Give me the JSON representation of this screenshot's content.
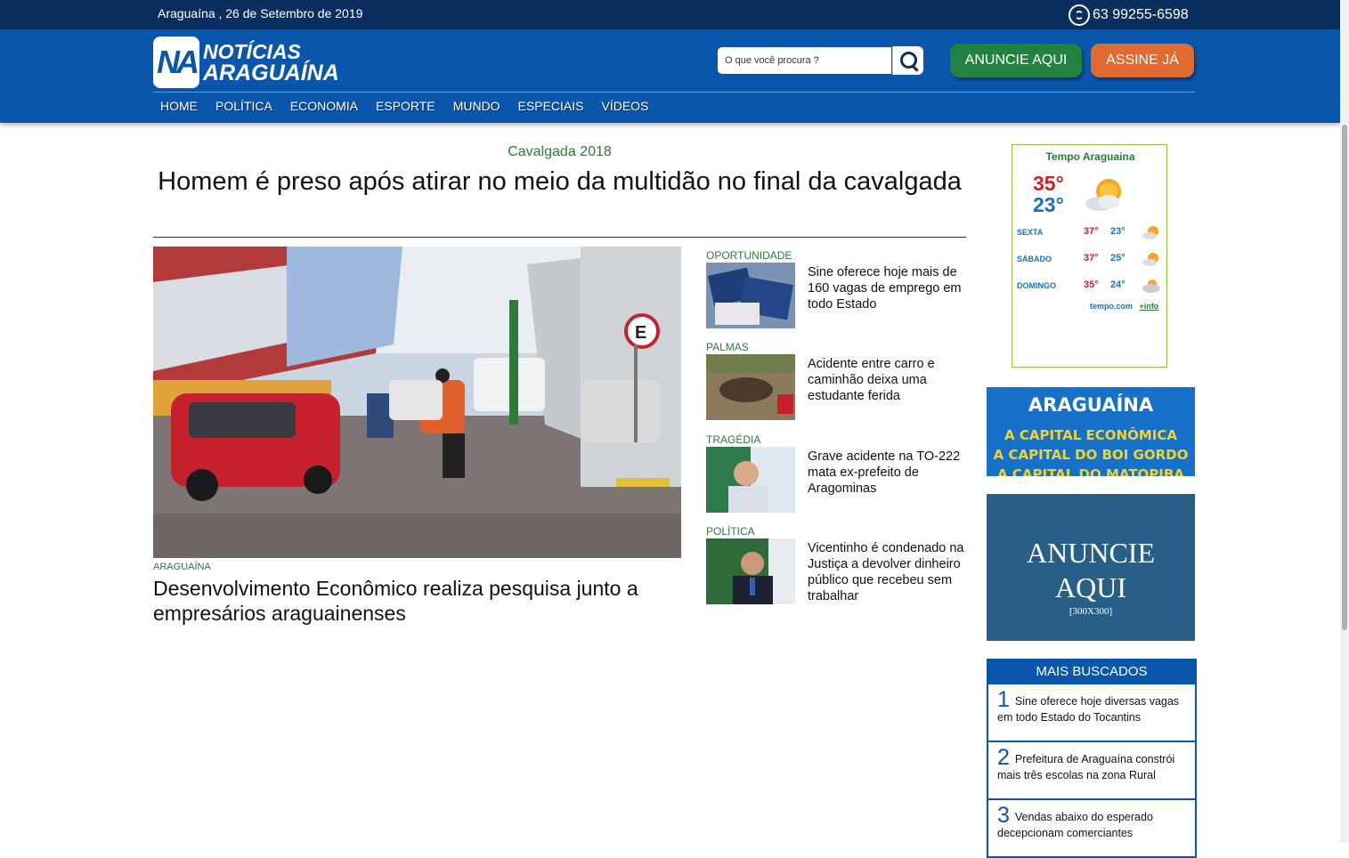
{
  "topbar": {
    "date": "Araguaína , 26 de Setembro de 2019",
    "phone": "63 99255-6598",
    "phone_icon": "whatsapp-icon"
  },
  "logo": {
    "mark": "NA",
    "line1": "NOTÍCIAS",
    "line2": "ARAGUAÍNA"
  },
  "search": {
    "placeholder": "O que você procura ?",
    "icon": "search-icon"
  },
  "buttons": {
    "anuncie": "ANUNCIE AQUI",
    "assine": "ASSINE JÁ"
  },
  "nav": [
    "HOME",
    "POLÍTICA",
    "ECONOMIA",
    "ESPORTE",
    "MUNDO",
    "ESPECIAIS",
    "VÍDEOS"
  ],
  "featured": {
    "kicker": "Cavalgada 2018",
    "headline": "Homem é preso após atirar no meio da multidão no final da cavalgada"
  },
  "main_story": {
    "category": "ARAGUAÍNA",
    "title": "Desenvolvimento Econômico realiza pesquisa junto a empresários araguainenses"
  },
  "side_stories": [
    {
      "category": "OPORTUNIDADE",
      "title": "Sine oferece hoje mais de 160 vagas de emprego em todo Estado"
    },
    {
      "category": "PALMAS",
      "title": "Acidente entre carro e caminhão deixa uma estudante ferida"
    },
    {
      "category": "TRAGÉDIA",
      "title": "Grave acidente na TO-222 mata ex-prefeito de Aragominas"
    },
    {
      "category": "POLÍTICA",
      "title": "Vicentinho é condenado na Justiça a devolver dinheiro público que recebeu sem trabalhar"
    }
  ],
  "weather": {
    "title": "Tempo Araguaina",
    "today_high": "35°",
    "today_low": "23°",
    "forecast": [
      {
        "day": "SEXTA",
        "high": "37°",
        "low": "23°"
      },
      {
        "day": "SÁBADO",
        "high": "37°",
        "low": "25°"
      },
      {
        "day": "DOMINGO",
        "high": "35°",
        "low": "24°"
      }
    ],
    "source": "tempo.com",
    "more": "+info"
  },
  "ad_banner": {
    "title": "ARAGUAÍNA",
    "line1": "A CAPITAL ECONÔMICA",
    "line2": "A CAPITAL DO BOI GORDO",
    "line3": "A CAPITAL DO MATOPIBA"
  },
  "ad_box": {
    "line1": "ANUNCIE",
    "line2": "AQUI",
    "size": "[300X300]"
  },
  "mais_buscados": {
    "title": "MAIS BUSCADOS",
    "items": [
      {
        "n": "1",
        "text": "Sine oferece hoje diversas vagas em todo Estado do Tocantins"
      },
      {
        "n": "2",
        "text": "Prefeitura de Araguaína constrói mais três escolas na zona Rural"
      },
      {
        "n": "3",
        "text": "Vendas abaixo do esperado decepcionam comerciantes"
      }
    ]
  },
  "colors": {
    "header": "#0b56ad",
    "topbar": "#0a2f5f",
    "accent_green": "#2a7a3c",
    "anuncie": "#23823f",
    "assine": "#e06a2f"
  }
}
